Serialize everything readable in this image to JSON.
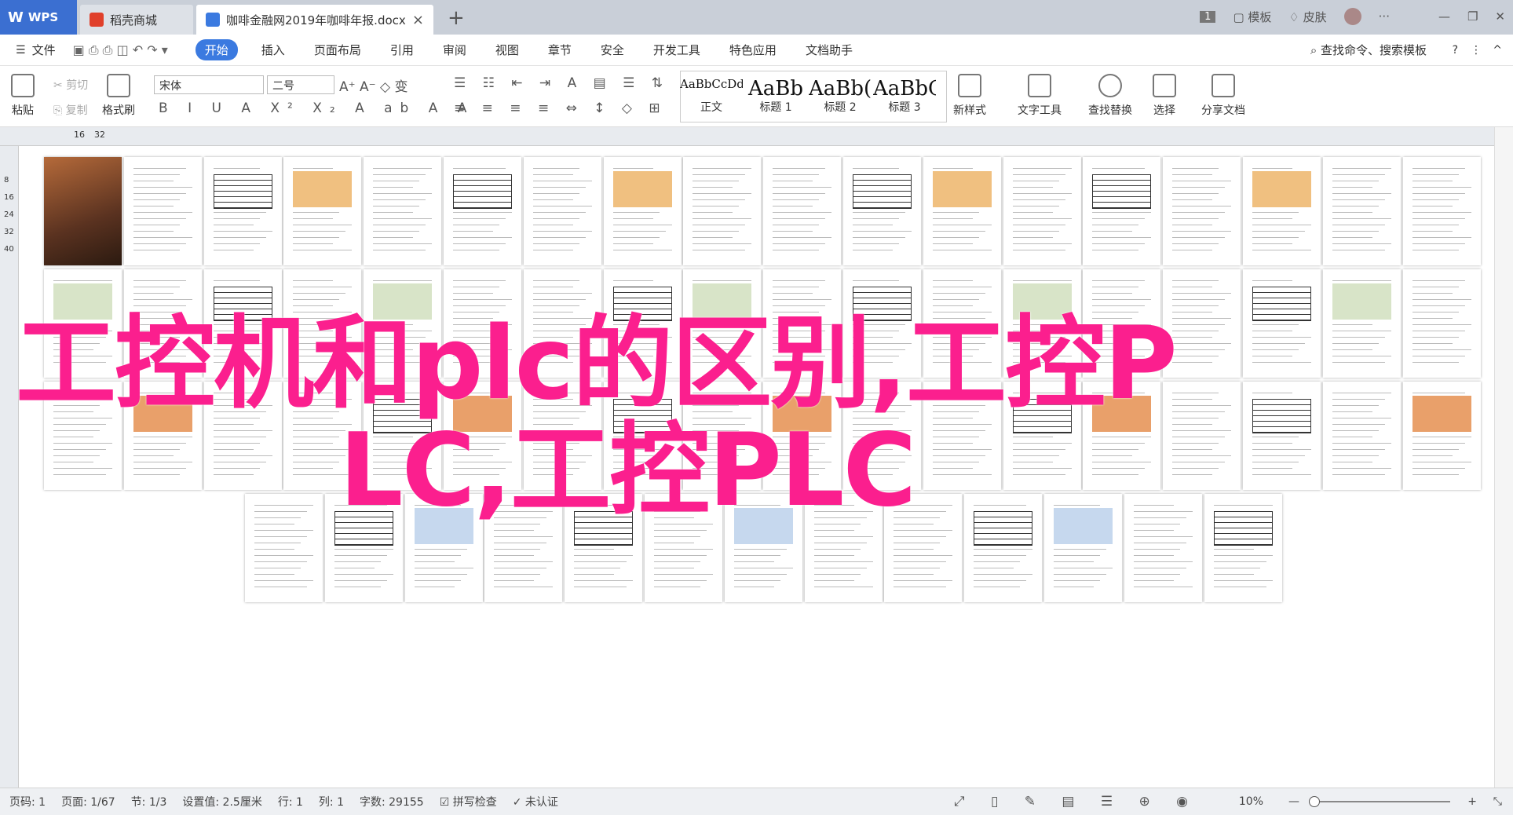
{
  "tabs": {
    "wps": "WPS",
    "shop": "稻壳商城",
    "doc": "咖啡金融网2019年咖啡年报.docx"
  },
  "topright": {
    "page_count": "1",
    "template": "模板",
    "skin": "皮肤"
  },
  "menu": {
    "file": "文件",
    "items": [
      "开始",
      "插入",
      "页面布局",
      "引用",
      "审阅",
      "视图",
      "章节",
      "安全",
      "开发工具",
      "特色应用",
      "文档助手"
    ],
    "search": "查找命令、搜索模板"
  },
  "ribbon": {
    "paste": "粘贴",
    "cut": "剪切",
    "copy": "复制",
    "format_painter": "格式刷",
    "font": "宋体",
    "size": "二号",
    "styles": [
      {
        "sample": "AaBbCcDd",
        "name": "正文"
      },
      {
        "sample": "AaBb",
        "name": "标题 1"
      },
      {
        "sample": "AaBb(",
        "name": "标题 2"
      },
      {
        "sample": "AaBbC(",
        "name": "标题 3"
      }
    ],
    "new_style": "新样式",
    "text_tools": "文字工具",
    "find_replace": "查找替换",
    "select": "选择",
    "share": "分享文档"
  },
  "ruler": {
    "h1": "16",
    "h2": "32",
    "v": [
      "8",
      "16",
      "24",
      "32",
      "40"
    ]
  },
  "overlay": {
    "line1": "工控机和plc的区别,工控P",
    "line2": "LC,工控PLC"
  },
  "status": {
    "pages": "页码: 1",
    "page": "页面: 1/67",
    "section": "节: 1/3",
    "setting": "设置值: 2.5厘米",
    "row": "行: 1",
    "col": "列: 1",
    "words": "字数: 29155",
    "spell": "拼写检查",
    "cert": "未认证",
    "zoom": "10%"
  },
  "colors": {
    "accent": "#3b7ae0",
    "overlay": "#fb1f8e"
  }
}
